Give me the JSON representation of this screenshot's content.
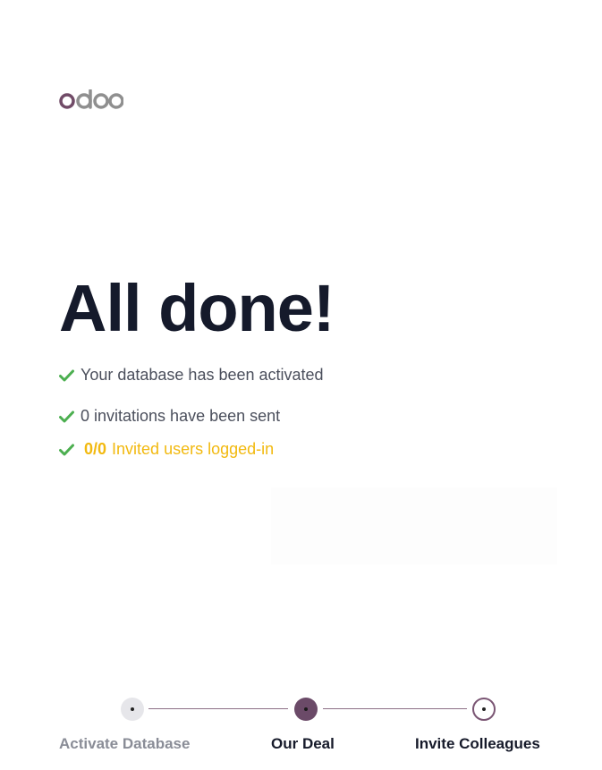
{
  "brand": {
    "logo_text": "odoo",
    "colors": {
      "primary_purple": "#714B67",
      "odoo_gray": "#8F8F8F"
    }
  },
  "main": {
    "title": "All done!",
    "checklist": [
      {
        "icon": "check-icon",
        "text": "Your database has been activated"
      },
      {
        "icon": "check-icon",
        "text": "0 invitations have been sent"
      },
      {
        "icon": "check-icon",
        "count": "0/0",
        "text": "Invited users logged-in",
        "color": "#F2B90F"
      }
    ],
    "check_color": "#4CAF50"
  },
  "stepper": {
    "steps": [
      {
        "label": "Activate Database",
        "state": "done"
      },
      {
        "label": "Our Deal",
        "state": "done"
      },
      {
        "label": "Invite Colleagues",
        "state": "current"
      }
    ]
  }
}
